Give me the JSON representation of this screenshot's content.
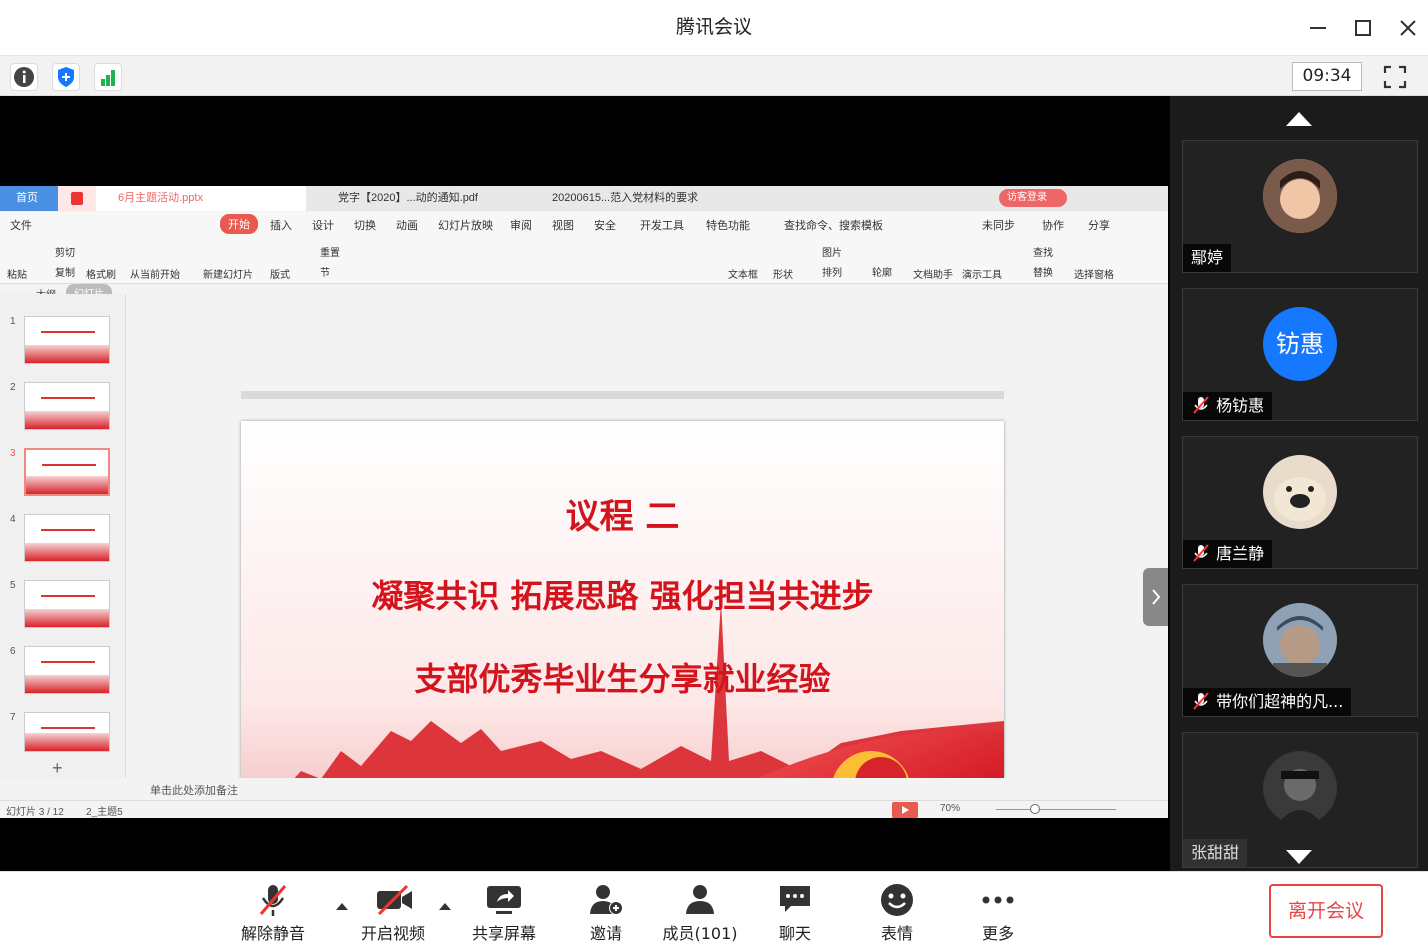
{
  "app": {
    "title": "腾讯会议",
    "clock": "09:34"
  },
  "ppt": {
    "tabs": [
      "首页",
      "6月主题活动.pptx",
      "党字【2020】...动的通知.pdf",
      "20200615...范入党材料的要求"
    ],
    "login": "访客登录",
    "menu": [
      "文件",
      "开始",
      "插入",
      "设计",
      "切换",
      "动画",
      "幻灯片放映",
      "审阅",
      "视图",
      "安全",
      "开发工具",
      "特色功能",
      "查找命令、搜索模板",
      "未同步",
      "协作",
      "分享"
    ],
    "ribbon": [
      "粘贴",
      "剪切",
      "复制",
      "格式刷",
      "从当前开始",
      "新建幻灯片",
      "版式",
      "重置",
      "节",
      "文本框",
      "形状",
      "图片",
      "排列",
      "轮廓",
      "文档助手",
      "演示工具",
      "查找",
      "替换",
      "选择窗格"
    ],
    "panel_tabs": [
      "大纲",
      "幻灯片"
    ],
    "thumb_numbers": [
      "1",
      "2",
      "3",
      "4",
      "5",
      "6",
      "7"
    ],
    "slide": {
      "line1": "议程 二",
      "line2": "凝聚共识  拓展思路  强化担当共进步",
      "line3": "支部优秀毕业生分享就业经验"
    },
    "notes_hint": "单击此处添加备注",
    "status_left": "幻灯片 3 / 12",
    "status_theme": "2_主题5",
    "zoom": "70%"
  },
  "participants": [
    {
      "name": "鄢婷",
      "muted": false
    },
    {
      "name": "杨钫惠",
      "avatar_text": "钫惠",
      "muted": true
    },
    {
      "name": "唐兰静",
      "muted": true
    },
    {
      "name": "带你们超神的凡...",
      "muted": true
    },
    {
      "name": "张甜甜",
      "muted": false
    }
  ],
  "toolbar": {
    "unmute": "解除静音",
    "video": "开启视频",
    "share": "共享屏幕",
    "invite": "邀请",
    "members": "成员(101)",
    "chat": "聊天",
    "emoji": "表情",
    "more": "更多",
    "leave": "离开会议"
  },
  "colors": {
    "accent": "#1677ff",
    "danger": "#e64545",
    "slide_red": "#d4141c"
  }
}
